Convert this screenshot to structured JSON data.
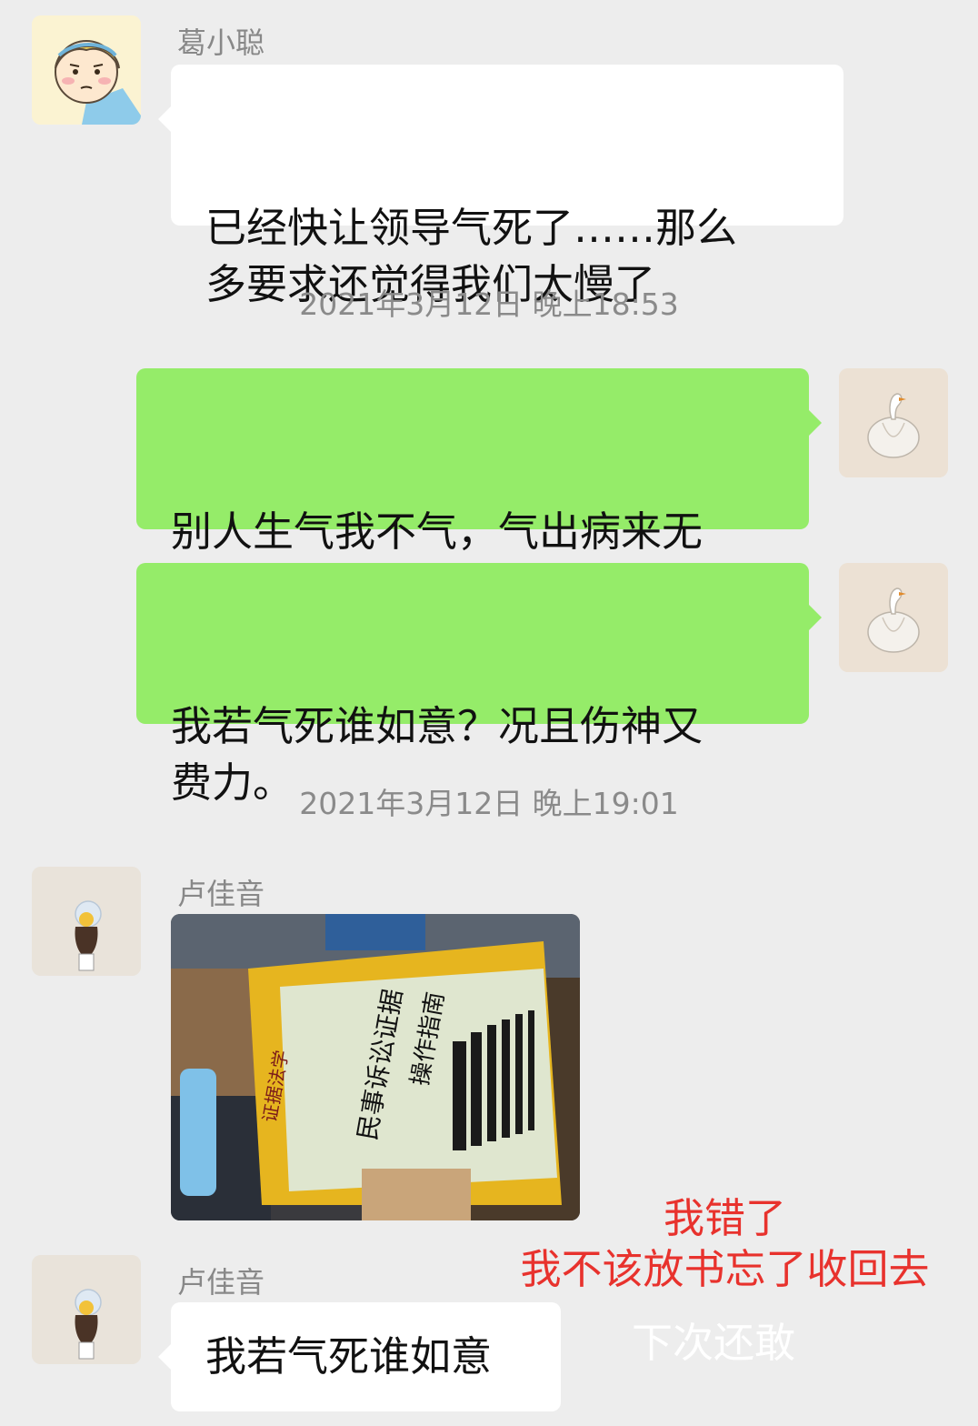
{
  "messages": [
    {
      "sender": "葛小聪",
      "text": "已经快让领导气死了……那么\n多要求还觉得我们太慢了"
    },
    {
      "timestamp": "2021年3月12日 晚上18:53"
    },
    {
      "text": "别人生气我不气，气出病来无\n人替。"
    },
    {
      "text": "我若气死谁如意？况且伤神又\n费力。"
    },
    {
      "timestamp": "2021年3月12日 晚上19:01"
    },
    {
      "sender": "卢佳音",
      "photo": {
        "book_title": "民事诉讼证据",
        "book_subtitle": "操作指南",
        "spine_text": "证据法学"
      }
    },
    {
      "sender": "卢佳音",
      "text": "我若气死谁如意"
    }
  ],
  "overlay": {
    "red_line1": "我错了",
    "red_line2": "我不该放书忘了收回去",
    "white_line": "下次还敢",
    "red_color": "#e8322d"
  },
  "colors": {
    "background": "#ededed",
    "incoming_bubble": "#ffffff",
    "outgoing_bubble": "#95ec69"
  }
}
